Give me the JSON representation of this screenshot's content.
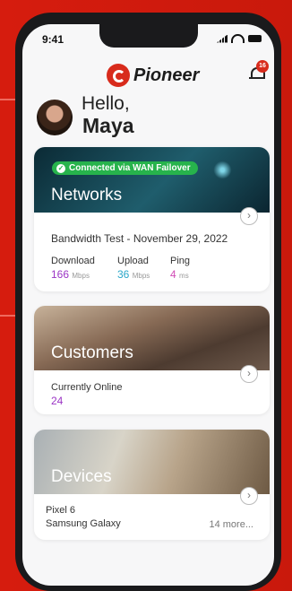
{
  "status_bar": {
    "time": "9:41"
  },
  "header": {
    "brand": "Pioneer",
    "notification_count": "16"
  },
  "greeting": {
    "hello": "Hello,",
    "name": "Maya"
  },
  "networks": {
    "badge": "Connected via WAN Failover",
    "title": "Networks",
    "test_title": "Bandwidth Test - November 29, 2022",
    "download": {
      "label": "Download",
      "value": "166",
      "unit": "Mbps"
    },
    "upload": {
      "label": "Upload",
      "value": "36",
      "unit": "Mbps"
    },
    "ping": {
      "label": "Ping",
      "value": "4",
      "unit": "ms"
    }
  },
  "customers": {
    "title": "Customers",
    "online_label": "Currently Online",
    "online_value": "24"
  },
  "devices": {
    "title": "Devices",
    "items": [
      "Pixel 6",
      "Samsung Galaxy"
    ],
    "more": "14 more..."
  },
  "colors": {
    "brand_red": "#d82b1c",
    "connected_green": "#27b34c",
    "download": "#9b35c5",
    "upload": "#2ba7c9",
    "ping": "#d04bb5"
  }
}
